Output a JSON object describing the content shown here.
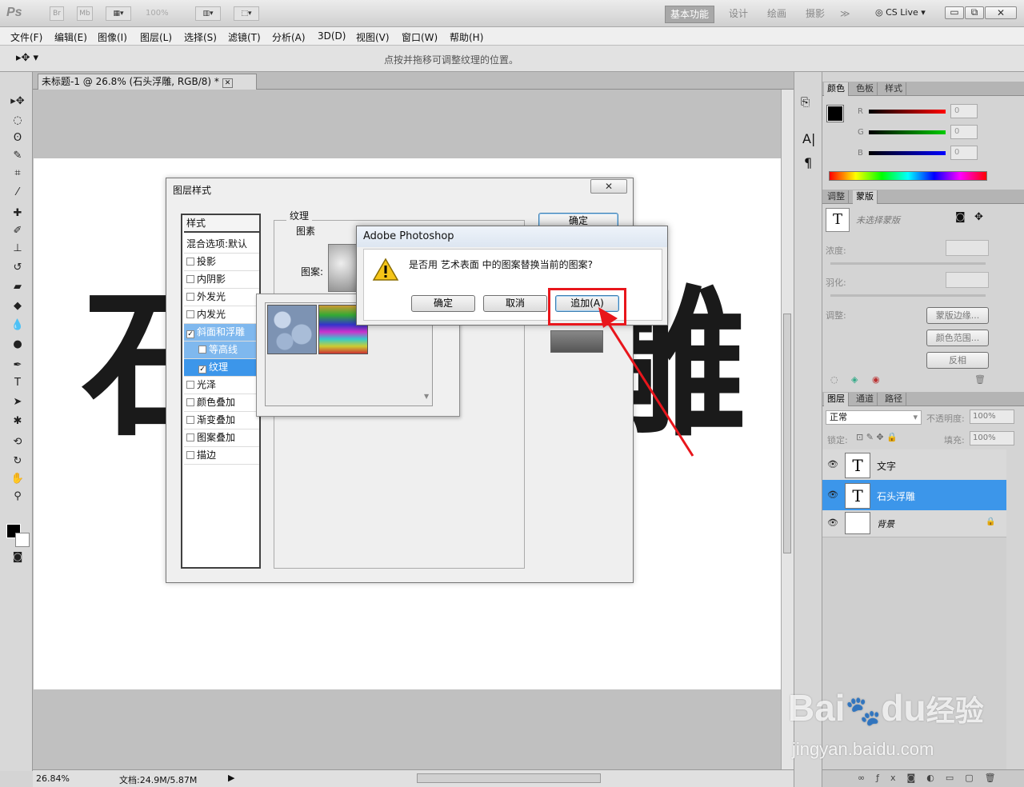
{
  "app": {
    "logo": "Ps",
    "bridge": "Br",
    "minibridge": "Mb",
    "zoom": "100%",
    "workspaces": [
      "基本功能",
      "设计",
      "绘画",
      "摄影"
    ],
    "more": "≫",
    "cslive": "CS Live"
  },
  "menu": [
    "文件(F)",
    "编辑(E)",
    "图像(I)",
    "图层(L)",
    "选择(S)",
    "滤镜(T)",
    "分析(A)",
    "3D(D)",
    "视图(V)",
    "窗口(W)",
    "帮助(H)"
  ],
  "options": {
    "hint": "点按并拖移可调整纹理的位置。"
  },
  "document": {
    "tab_title": "未标题-1 @ 26.8% (石头浮雕, RGB/8) *",
    "canvas_text_left": "石",
    "canvas_text_right": "雕",
    "zoom": "26.84%",
    "doc_size": "文档:24.9M/5.87M"
  },
  "layer_style": {
    "title": "图层样式",
    "styles_header": "样式",
    "blend_default": "混合选项:默认",
    "items": [
      {
        "label": "投影",
        "checked": false
      },
      {
        "label": "内阴影",
        "checked": false
      },
      {
        "label": "外发光",
        "checked": false
      },
      {
        "label": "内发光",
        "checked": false
      },
      {
        "label": "斜面和浮雕",
        "checked": true,
        "highlight": true
      },
      {
        "label": "等高线",
        "checked": false,
        "sub": true
      },
      {
        "label": "纹理",
        "checked": true,
        "sub": true,
        "selected": true
      },
      {
        "label": "光泽",
        "checked": false
      },
      {
        "label": "颜色叠加",
        "checked": false
      },
      {
        "label": "渐变叠加",
        "checked": false
      },
      {
        "label": "图案叠加",
        "checked": false
      },
      {
        "label": "描边",
        "checked": false
      }
    ],
    "group_texture": "纹理",
    "group_pattern": "图素",
    "pattern_label": "图案:",
    "ok": "确定",
    "cancel": "取消"
  },
  "alert": {
    "title": "Adobe Photoshop",
    "message": "是否用 艺术表面 中的图案替换当前的图案?",
    "ok": "确定",
    "cancel": "取消",
    "append": "追加(A)"
  },
  "color_panel": {
    "tabs": [
      "颜色",
      "色板",
      "样式"
    ],
    "channels": [
      {
        "name": "R",
        "value": "0"
      },
      {
        "name": "G",
        "value": "0"
      },
      {
        "name": "B",
        "value": "0"
      }
    ]
  },
  "masks_panel": {
    "tabs": [
      "调整",
      "蒙版"
    ],
    "no_mask": "未选择蒙版",
    "density": "浓度:",
    "feather": "羽化:",
    "refine": "调整:",
    "mask_edge": "蒙版边缘...",
    "color_range": "颜色范围...",
    "invert": "反相"
  },
  "layers_panel": {
    "tabs": [
      "图层",
      "通道",
      "路径"
    ],
    "blend": "正常",
    "opacity_label": "不透明度:",
    "opacity": "100%",
    "lock_label": "锁定:",
    "fill_label": "填充:",
    "fill": "100%",
    "layers": [
      {
        "name": "文字",
        "type": "text"
      },
      {
        "name": "石头浮雕",
        "type": "text",
        "selected": true
      },
      {
        "name": "背景",
        "type": "bg"
      }
    ]
  },
  "watermark": {
    "brand": "Bai",
    "brand2": "du",
    "site": "经验",
    "url": "jingyan.baidu.com"
  },
  "colors": {
    "highlight": "#3c96ea",
    "annotation": "#e8161c"
  }
}
